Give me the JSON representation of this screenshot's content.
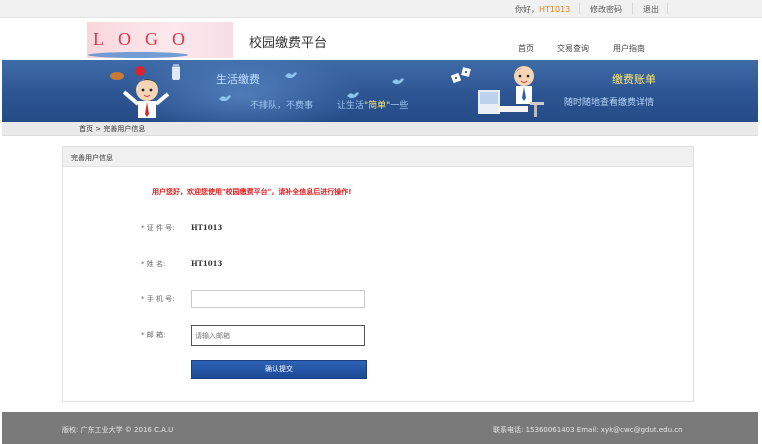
{
  "topbar": {
    "greeting_prefix": "你好，",
    "user_id": "HT1013",
    "change_password": "修改密码",
    "logout": "退出"
  },
  "header": {
    "logo_text": "LOGO",
    "site_title": "校园缴费平台",
    "nav": [
      "首页",
      "交易查询",
      "用户指南"
    ]
  },
  "banner": {
    "life_pay": "生活缴费",
    "slogan_part1": "不排队，不费事",
    "slogan_part2": "让生活",
    "slogan_highlight": "简单",
    "slogan_part3": "一些",
    "bill_title": "缴费账单",
    "bill_sub": "随时随地查看缴费详情"
  },
  "breadcrumb": "首页 > 完善用户信息",
  "panel": {
    "title": "完善用户信息",
    "notice": "用户您好，欢迎您使用\"校园缴费平台\"，请补全信息后进行操作!",
    "rows": [
      {
        "label": "* 证 件 号:",
        "value": "HT1013"
      },
      {
        "label": "* 姓      名:",
        "value": "HT1013"
      },
      {
        "label": "* 手 机 号:",
        "value": ""
      },
      {
        "label": "* 邮      箱:",
        "value": ""
      }
    ],
    "email_placeholder": "请输入邮箱",
    "submit_label": "确认提交"
  },
  "footer": {
    "copyright": "版权: 广东工业大学 © 2016 C.A.U",
    "contact": "联系电话: 15360061403 Email: xyk@cwc@gdut.edu.cn"
  },
  "colors": {
    "accent_blue": "#244b86",
    "notice_red": "#e02020",
    "user_orange": "#e4821a",
    "footer_gray": "#7a7a7a"
  }
}
